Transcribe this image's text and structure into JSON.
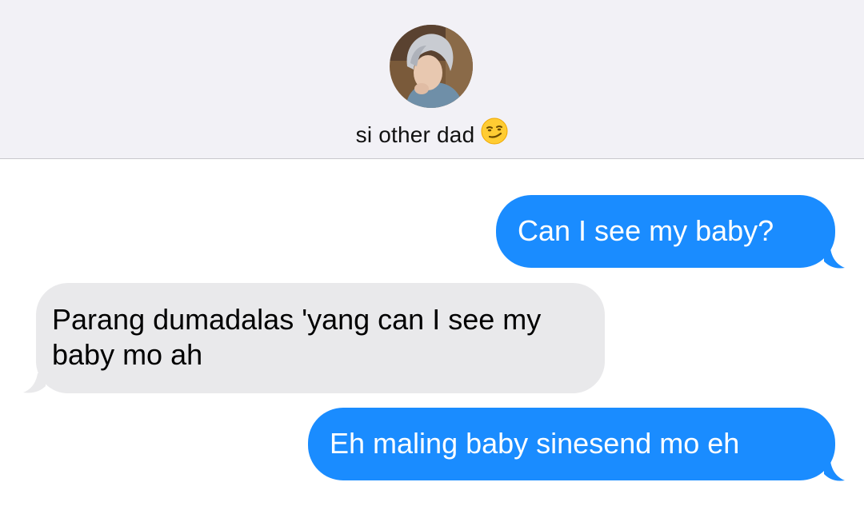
{
  "contact": {
    "name": "si other dad",
    "emoji": "smirking-face",
    "avatar": "contact-photo"
  },
  "colors": {
    "header_bg": "#f2f1f6",
    "sent_bubble": "#1a8cff",
    "received_bubble": "#e9e9eb"
  },
  "messages": [
    {
      "direction": "sent",
      "text": "Can I see my baby?"
    },
    {
      "direction": "received",
      "text": "Parang dumadalas 'yang can I see my baby mo ah"
    },
    {
      "direction": "sent",
      "text": "Eh maling baby sinesend mo eh"
    }
  ]
}
